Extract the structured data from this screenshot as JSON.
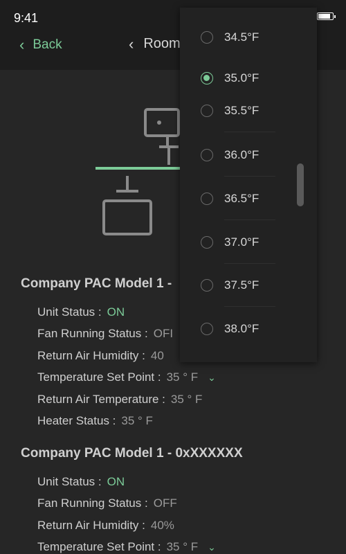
{
  "status_bar": {
    "time": "9:41"
  },
  "nav": {
    "back_label": "Back",
    "title": "Room"
  },
  "devices": [
    {
      "name": "Company PAC Model 1 -",
      "rows": [
        {
          "label": "Unit Status :",
          "value": "ON"
        },
        {
          "label": "Fan Running Status :",
          "value": "OFI"
        },
        {
          "label": "Return Air Humidity :",
          "value": "40"
        },
        {
          "label": "Temperature Set Point :",
          "value": "35 ° F"
        },
        {
          "label": "Return Air Temperature :",
          "value": "35 ° F"
        },
        {
          "label": "Heater Status :",
          "value": "35 ° F"
        }
      ]
    },
    {
      "name": "Company PAC Model 1 - 0xXXXXXX",
      "rows": [
        {
          "label": "Unit Status :",
          "value": "ON"
        },
        {
          "label": "Fan Running Status :",
          "value": "OFF"
        },
        {
          "label": "Return Air Humidity :",
          "value": "40%"
        },
        {
          "label": "Temperature Set Point :",
          "value": "35 ° F"
        }
      ]
    }
  ],
  "dropdown": {
    "options": [
      "34.5°F",
      "35.0°F",
      "35.5°F",
      "36.0°F",
      "36.5°F",
      "37.0°F",
      "37.5°F",
      "38.0°F"
    ],
    "selected": "35.0°F"
  },
  "colors": {
    "accent": "#7ccb98",
    "background": "#262626",
    "header": "#1d1d1d",
    "menu": "#222222"
  },
  "icons": {
    "back": "chevron-left-icon",
    "title_back": "chevron-left-icon",
    "set_point_dropdown": "chevron-down-icon",
    "illustration": "pac-unit-diagram-icon"
  }
}
